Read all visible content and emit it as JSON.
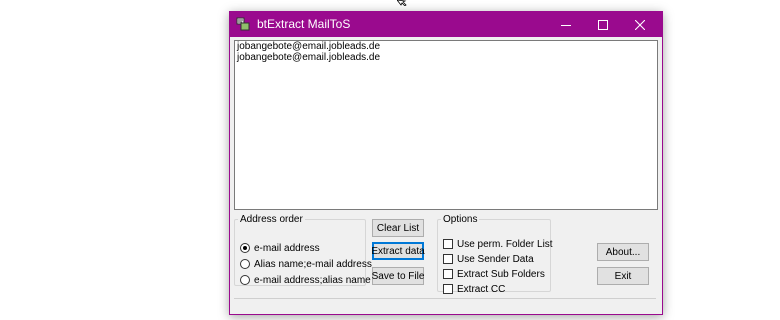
{
  "window": {
    "title": "btExtract MailToS",
    "title_bar_color": "#9a0a8e"
  },
  "list": {
    "items": [
      "jobangebote@email.jobleads.de",
      "jobangebote@email.jobleads.de"
    ]
  },
  "address_order": {
    "legend": "Address order",
    "options": [
      {
        "label": "e-mail address",
        "selected": true
      },
      {
        "label": "Alias name;e-mail address",
        "selected": false
      },
      {
        "label": "e-mail address;alias name",
        "selected": false
      }
    ]
  },
  "buttons": {
    "clear_list": "Clear List",
    "extract_data": "Extract data",
    "save_to_file": "Save to File",
    "about": "About...",
    "exit": "Exit"
  },
  "options": {
    "legend": "Options",
    "items": [
      {
        "label": "Use perm. Folder List",
        "checked": false
      },
      {
        "label": "Use Sender Data",
        "checked": false
      },
      {
        "label": "Extract Sub Folders",
        "checked": false
      },
      {
        "label": "Extract CC",
        "checked": false
      }
    ]
  }
}
